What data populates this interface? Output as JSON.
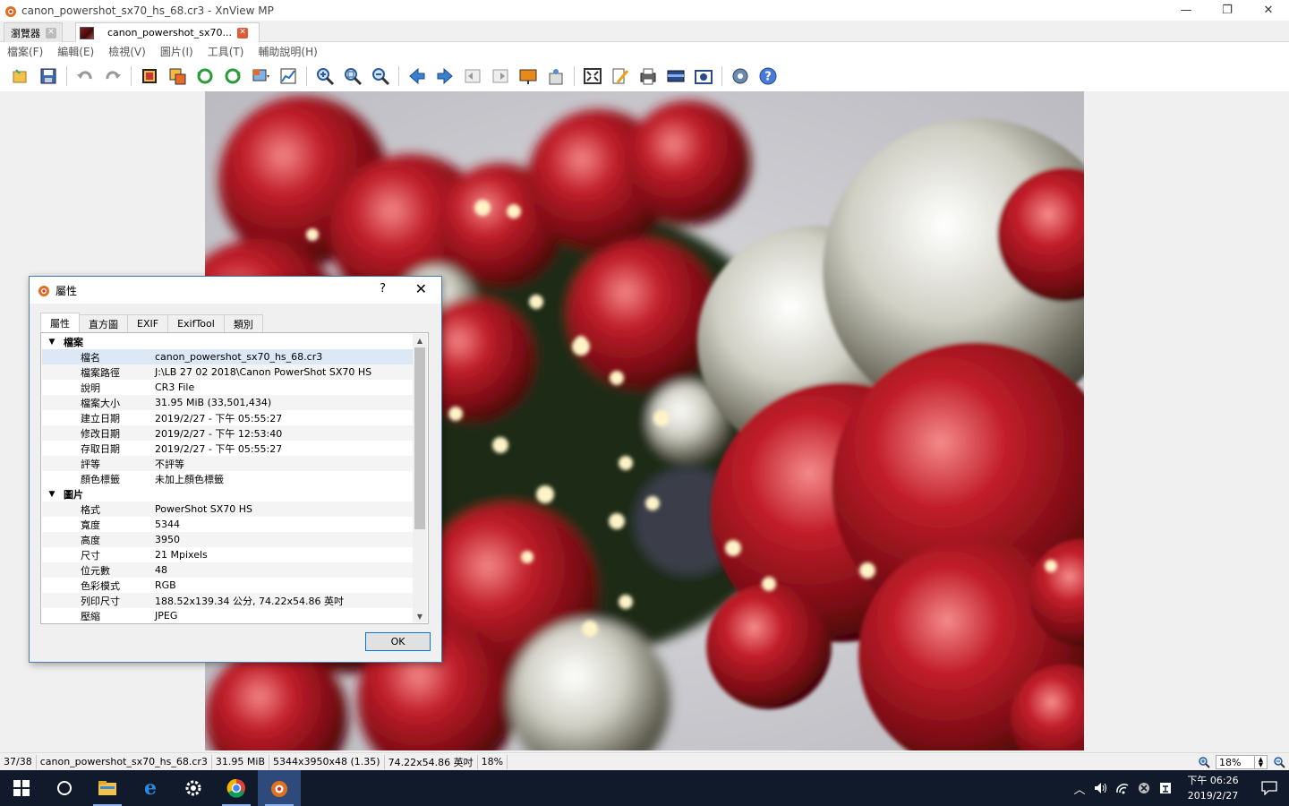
{
  "window": {
    "title": "canon_powershot_sx70_hs_68.cr3 - XnView MP",
    "minimize": "—",
    "restore": "❐",
    "close": "✕"
  },
  "tabs": [
    {
      "label": "瀏覽器",
      "close": "✕"
    },
    {
      "label": "canon_powershot_sx70...",
      "close": "✕"
    }
  ],
  "menu": [
    "檔案(F)",
    "編輯(E)",
    "檢視(V)",
    "圖片(I)",
    "工具(T)",
    "輔助說明(H)"
  ],
  "toolbar": {
    "icons": [
      "open-folder-icon",
      "save-icon",
      "undo-icon",
      "redo-icon",
      "crop-icon",
      "resize-icon",
      "rotate-left-icon",
      "rotate-right-icon",
      "adjust-icon",
      "levels-icon",
      "zoom-in-icon",
      "zoom-fit-icon",
      "zoom-out-icon",
      "previous-icon",
      "next-icon",
      "first-icon",
      "last-icon",
      "slideshow-icon",
      "properties-icon",
      "fullscreen-icon",
      "edit-icon",
      "print-icon",
      "scanner-icon",
      "capture-icon",
      "settings-icon",
      "help-icon"
    ]
  },
  "dialog": {
    "title": "屬性",
    "help": "?",
    "close": "✕",
    "tabs": [
      "屬性",
      "直方圖",
      "EXIF",
      "ExifTool",
      "類別"
    ],
    "ok": "OK",
    "sections": [
      {
        "name": "檔案",
        "rows": [
          {
            "key": "檔名",
            "value": "canon_powershot_sx70_hs_68.cr3"
          },
          {
            "key": "檔案路徑",
            "value": "J:\\LB 27 02 2018\\Canon PowerShot SX70 HS"
          },
          {
            "key": "說明",
            "value": "CR3 File"
          },
          {
            "key": "檔案大小",
            "value": "31.95 MiB (33,501,434)"
          },
          {
            "key": "建立日期",
            "value": "2019/2/27 - 下午 05:55:27"
          },
          {
            "key": "修改日期",
            "value": "2019/2/27 - 下午 12:53:40"
          },
          {
            "key": "存取日期",
            "value": "2019/2/27 - 下午 05:55:27"
          },
          {
            "key": "評等",
            "value": "不評等"
          },
          {
            "key": "顏色標籤",
            "value": "未加上顏色標籤"
          }
        ]
      },
      {
        "name": "圖片",
        "rows": [
          {
            "key": "格式",
            "value": "PowerShot SX70 HS"
          },
          {
            "key": "寬度",
            "value": "5344"
          },
          {
            "key": "高度",
            "value": "3950"
          },
          {
            "key": "尺寸",
            "value": "21 Mpixels"
          },
          {
            "key": "位元數",
            "value": "48"
          },
          {
            "key": "色彩模式",
            "value": "RGB"
          },
          {
            "key": "列印尺寸",
            "value": "188.52x139.34 公分, 74.22x54.86 英吋"
          },
          {
            "key": "壓縮",
            "value": "JPEG"
          }
        ]
      }
    ]
  },
  "status": {
    "index": "37/38",
    "filename": "canon_powershot_sx70_hs_68.cr3",
    "size": "31.95 MiB",
    "dimensions": "5344x3950x48 (1.35)",
    "print_size": "74.22x54.86 英吋",
    "zoom": "18%",
    "zoom_field": "18%"
  },
  "taskbar": {
    "clock_time": "下午 06:26",
    "clock_date": "2019/2/27",
    "apps": [
      "start-icon",
      "cortana-icon",
      "file-explorer-icon",
      "edge-icon",
      "settings-icon",
      "chrome-icon",
      "xnview-icon"
    ]
  }
}
